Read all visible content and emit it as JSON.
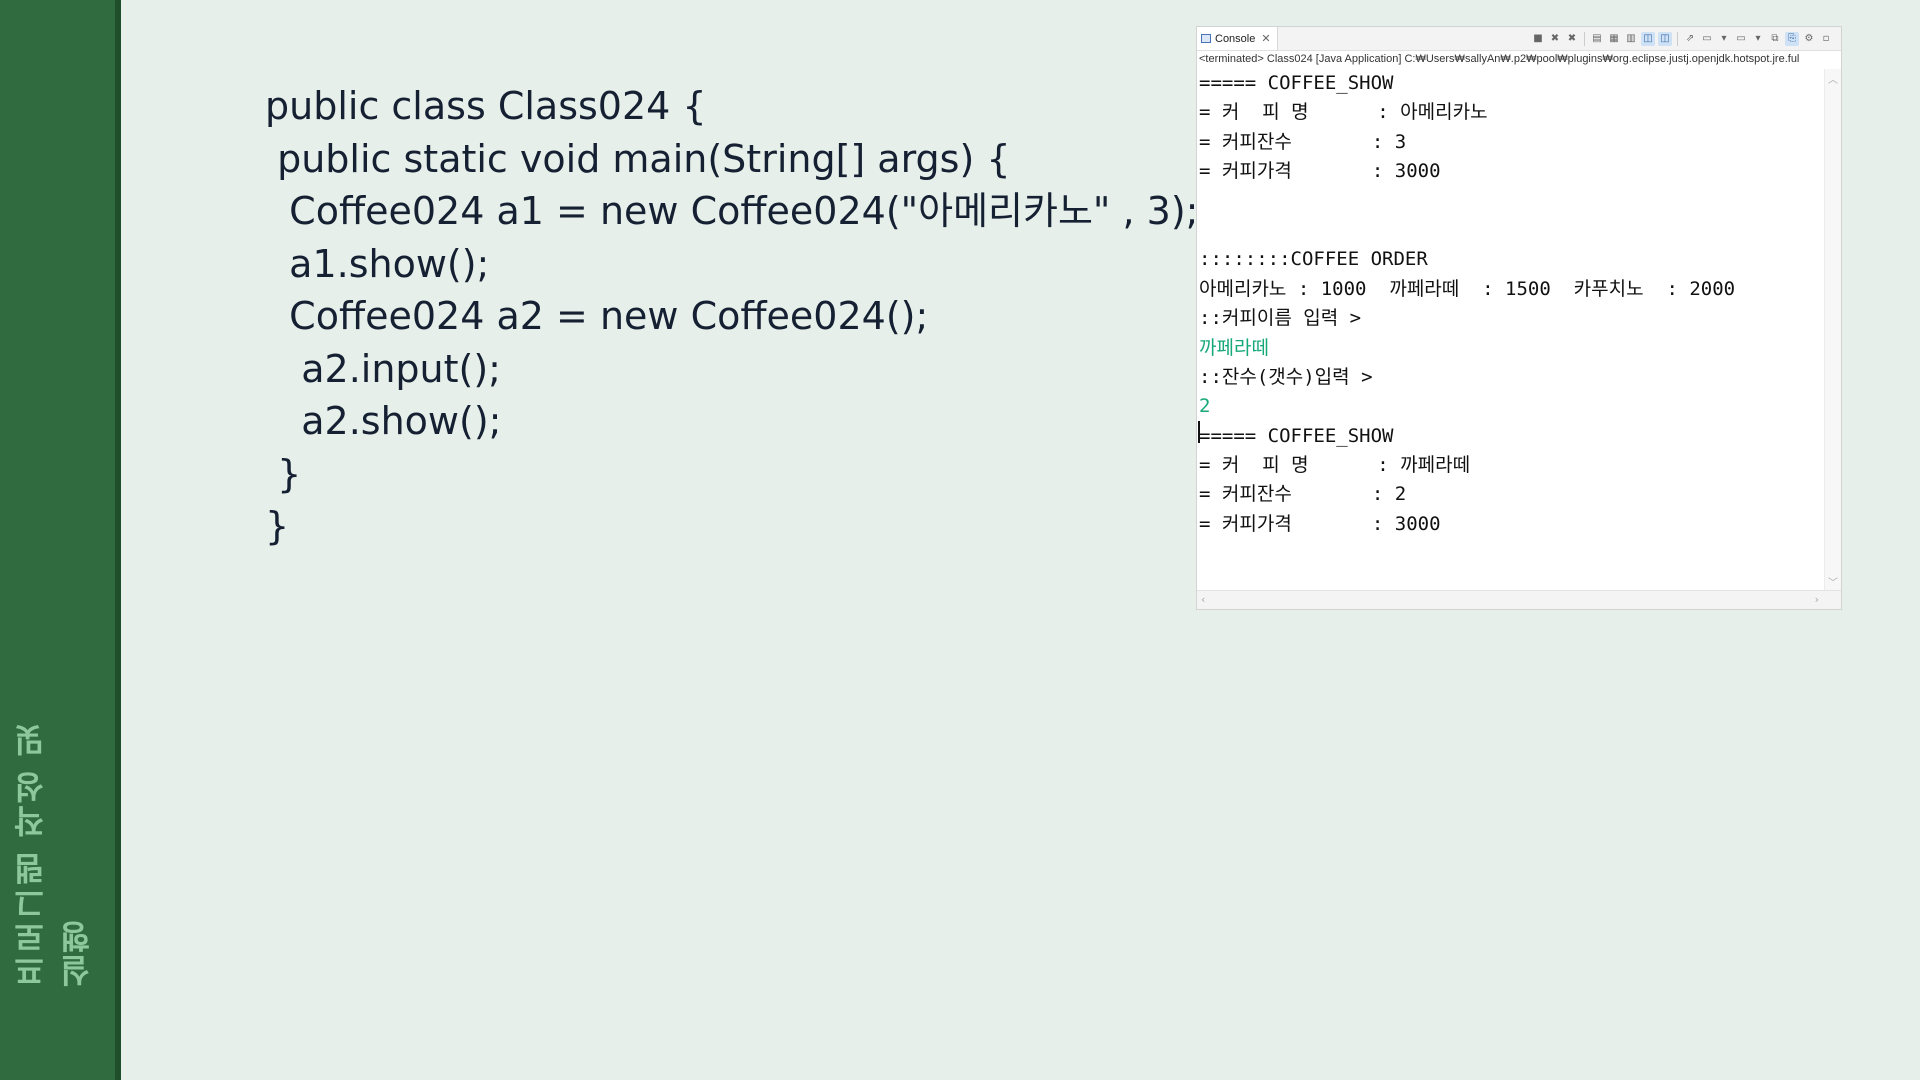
{
  "sidebar": {
    "title": "프로그램 작성 및 실행"
  },
  "code": {
    "lines": [
      "public class Class024 {",
      " public static void main(String[] args) {",
      "  Coffee024 a1 = new Coffee024(\"아메리카노\" , 3);",
      "  a1.show();",
      "  Coffee024 a2 = new Coffee024();",
      "   a2.input();",
      "   a2.show();",
      " }",
      "}"
    ]
  },
  "console": {
    "tab_label": "Console",
    "path": "<terminated> Class024 [Java Application] C:₩Users₩sallyAn₩.p2₩pool₩plugins₩org.eclipse.justj.openjdk.hotspot.jre.ful",
    "lines": [
      {
        "text": "===== COFFEE_SHOW",
        "input": false
      },
      {
        "text": "= 커  피 명      : 아메리카노",
        "input": false
      },
      {
        "text": "= 커피잔수       : 3",
        "input": false
      },
      {
        "text": "= 커피가격       : 3000",
        "input": false
      },
      {
        "text": "",
        "input": false
      },
      {
        "text": "",
        "input": false
      },
      {
        "text": "::::::::COFFEE ORDER",
        "input": false
      },
      {
        "text": "아메리카노 : 1000  까페라떼  : 1500  카푸치노  : 2000",
        "input": false
      },
      {
        "text": "::커피이름 입력 >",
        "input": false
      },
      {
        "text": "까페라떼",
        "input": true
      },
      {
        "text": "::잔수(갯수)입력 >",
        "input": false
      },
      {
        "text": "2",
        "input": true
      },
      {
        "text": "===== COFFEE_SHOW",
        "input": false
      },
      {
        "text": "= 커  피 명      : 까페라떼",
        "input": false
      },
      {
        "text": "= 커피잔수       : 2",
        "input": false
      },
      {
        "text": "= 커피가격       : 3000",
        "input": false
      }
    ]
  },
  "icons": [
    "terminate-icon",
    "remove-launch-icon",
    "remove-all-icon",
    "clear-console-icon",
    "scroll-lock-icon",
    "word-wrap-icon",
    "show-stdout-icon",
    "show-stderr-icon",
    "pin-console-icon",
    "display-console-icon",
    "open-console-icon",
    "minimize-icon",
    "maximize-icon"
  ]
}
